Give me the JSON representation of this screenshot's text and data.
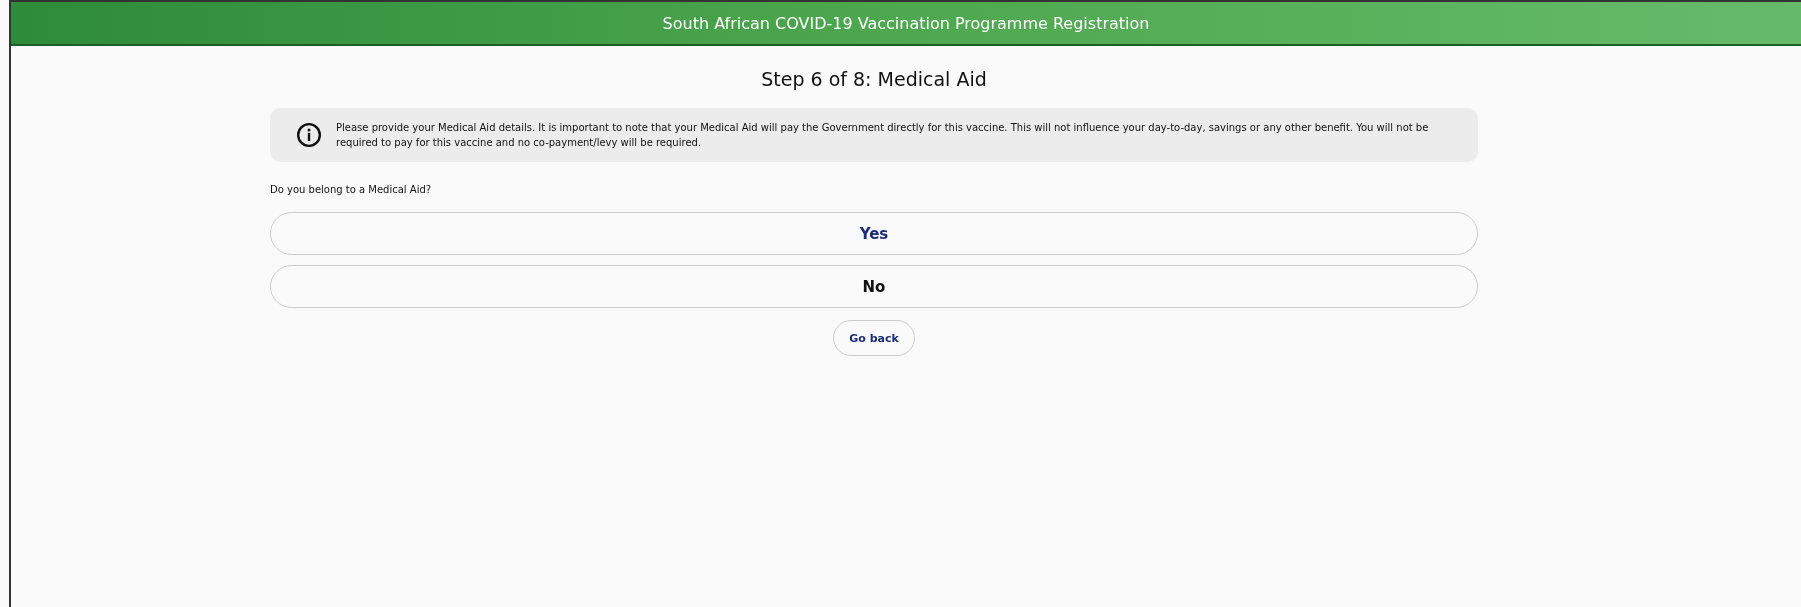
{
  "header": {
    "title": "South African COVID-19 Vaccination Programme Registration"
  },
  "step_title": "Step 6 of 8: Medical Aid",
  "info": {
    "text": "Please provide your Medical Aid details. It is important to note that your Medical Aid will pay the Government directly for this vaccine. This will not influence your day-to-day, savings or any other benefit. You will not be required to pay for this vaccine and no co-payment/levy will be required."
  },
  "question": "Do you belong to a Medical Aid?",
  "options": [
    {
      "label": "Yes",
      "selected": true
    },
    {
      "label": "No",
      "selected": false
    }
  ],
  "back_button": "Go back"
}
